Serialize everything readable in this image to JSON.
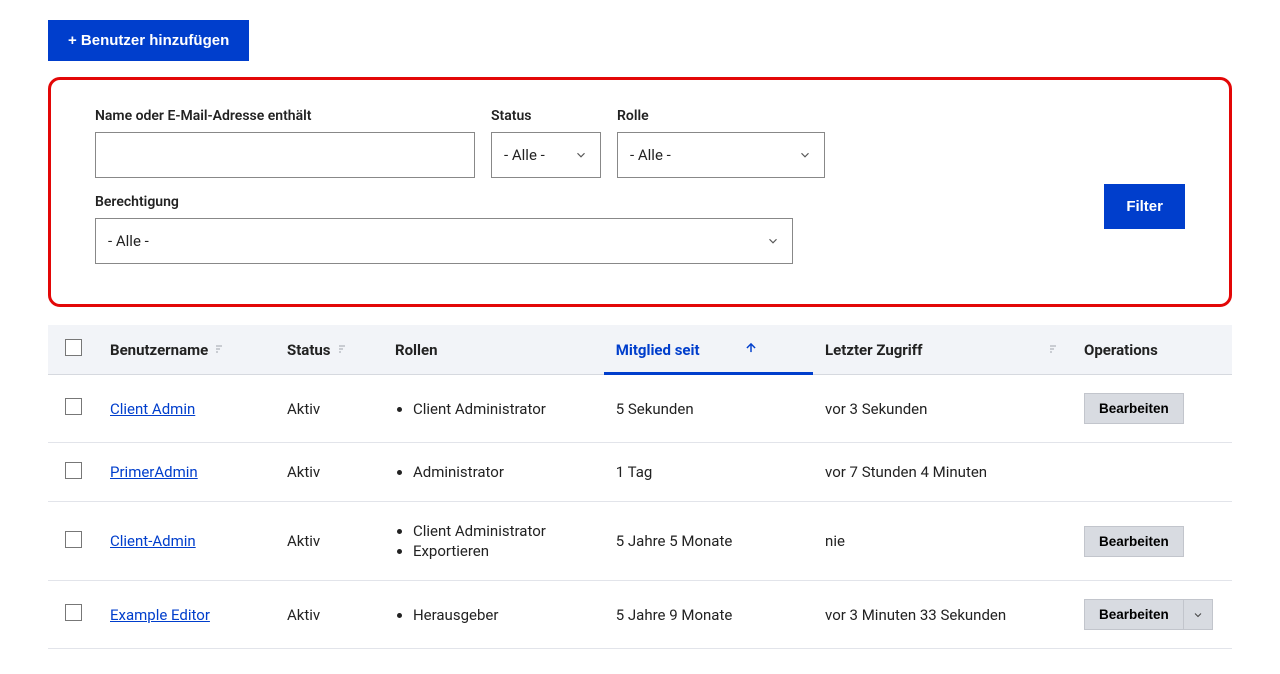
{
  "buttons": {
    "add_user": "+ Benutzer hinzufügen",
    "filter": "Filter",
    "edit": "Bearbeiten"
  },
  "filters": {
    "name_label": "Name oder E-Mail-Adresse enthält",
    "name_value": "",
    "status_label": "Status",
    "status_value": "- Alle -",
    "role_label": "Rolle",
    "role_value": "- Alle -",
    "permission_label": "Berechtigung",
    "permission_value": "- Alle -"
  },
  "table": {
    "headers": {
      "username": "Benutzername",
      "status": "Status",
      "roles": "Rollen",
      "member_since": "Mitglied seit",
      "last_access": "Letzter Zugriff",
      "operations": "Operations"
    },
    "rows": [
      {
        "username": "Client Admin",
        "status": "Aktiv",
        "roles": [
          "Client Administrator"
        ],
        "member_since": "5 Sekunden",
        "last_access": "vor 3 Sekunden",
        "has_edit": true,
        "has_dropdown": false
      },
      {
        "username": "PrimerAdmin",
        "status": "Aktiv",
        "roles": [
          "Administrator"
        ],
        "member_since": "1 Tag",
        "last_access": "vor 7 Stunden 4 Minuten",
        "has_edit": false,
        "has_dropdown": false
      },
      {
        "username": "Client-Admin",
        "status": "Aktiv",
        "roles": [
          "Client Administrator",
          "Exportieren"
        ],
        "member_since": "5 Jahre 5 Monate",
        "last_access": "nie",
        "has_edit": true,
        "has_dropdown": false
      },
      {
        "username": "Example Editor",
        "status": "Aktiv",
        "roles": [
          "Herausgeber"
        ],
        "member_since": "5 Jahre 9 Monate",
        "last_access": "vor 3 Minuten 33 Sekunden",
        "has_edit": true,
        "has_dropdown": true
      }
    ]
  }
}
